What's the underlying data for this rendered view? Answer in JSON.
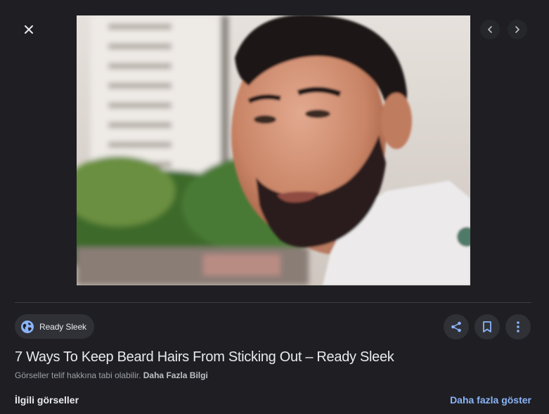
{
  "toolbar": {
    "close_icon": "close-icon",
    "prev_icon": "chevron-left-icon",
    "next_icon": "chevron-right-icon"
  },
  "image": {
    "description_icon": "photo"
  },
  "source": {
    "name": "Ready Sleek",
    "icon": "globe-icon"
  },
  "actions": {
    "share_icon": "share-icon",
    "save_icon": "bookmark-icon",
    "more_icon": "more-vert-icon"
  },
  "title": "7 Ways To Keep Beard Hairs From Sticking Out – Ready Sleek",
  "copyright": {
    "text": "Görseller telif hakkına tabi olabilir.",
    "link": "Daha Fazla Bilgi"
  },
  "related": {
    "heading": "İlgili görseller",
    "show_more": "Daha fazla göster"
  },
  "colors": {
    "background": "#1f1f23",
    "accent": "#8ab4f8",
    "chip": "#303136"
  }
}
